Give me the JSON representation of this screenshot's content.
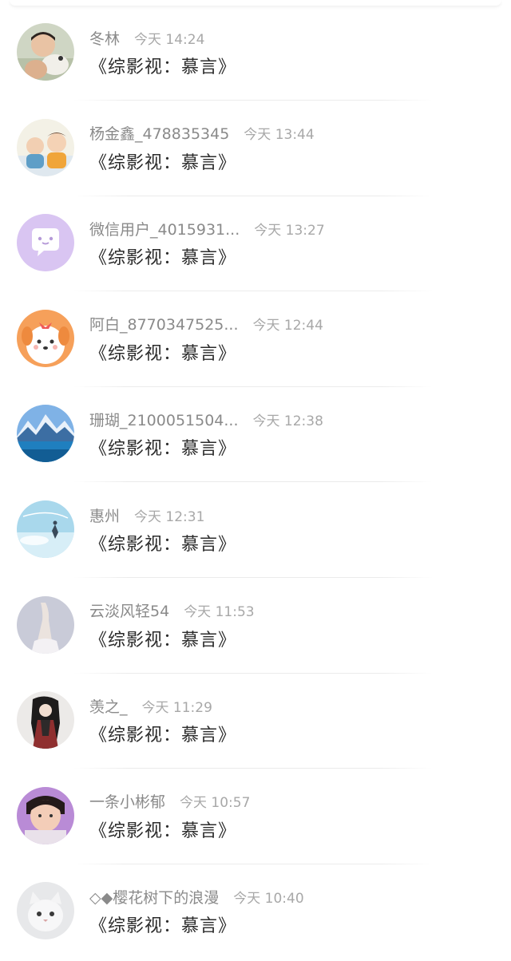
{
  "messages": [
    {
      "sender": "冬林",
      "time": "今天 14:24",
      "text": "《综影视：慕言》",
      "avatar": "boy-with-dog"
    },
    {
      "sender": "杨金鑫_478835345",
      "time": "今天 13:44",
      "text": "《综影视：慕言》",
      "avatar": "two-babies"
    },
    {
      "sender": "微信用户_4015931...",
      "time": "今天 13:27",
      "text": "《综影视：慕言》",
      "avatar": "purple-chat-bubble"
    },
    {
      "sender": "阿白_8770347525...",
      "time": "今天 12:44",
      "text": "《综影视：慕言》",
      "avatar": "cartoon-dog"
    },
    {
      "sender": "珊瑚_2100051504...",
      "time": "今天 12:38",
      "text": "《综影视：慕言》",
      "avatar": "mountain-lake"
    },
    {
      "sender": "惠州",
      "time": "今天 12:31",
      "text": "《综影视：慕言》",
      "avatar": "anime-sky"
    },
    {
      "sender": "云淡风轻54",
      "time": "今天 11:53",
      "text": "《综影视：慕言》",
      "avatar": "raised-hand"
    },
    {
      "sender": "羡之_",
      "time": "今天 11:29",
      "text": "《综影视：慕言》",
      "avatar": "anime-character"
    },
    {
      "sender": "一条小彬郁",
      "time": "今天 10:57",
      "text": "《综影视：慕言》",
      "avatar": "boy-portrait"
    },
    {
      "sender": "◇◆樱花树下的浪漫",
      "time": "今天 10:40",
      "text": "《综影视：慕言》",
      "avatar": "white-kitten"
    }
  ]
}
